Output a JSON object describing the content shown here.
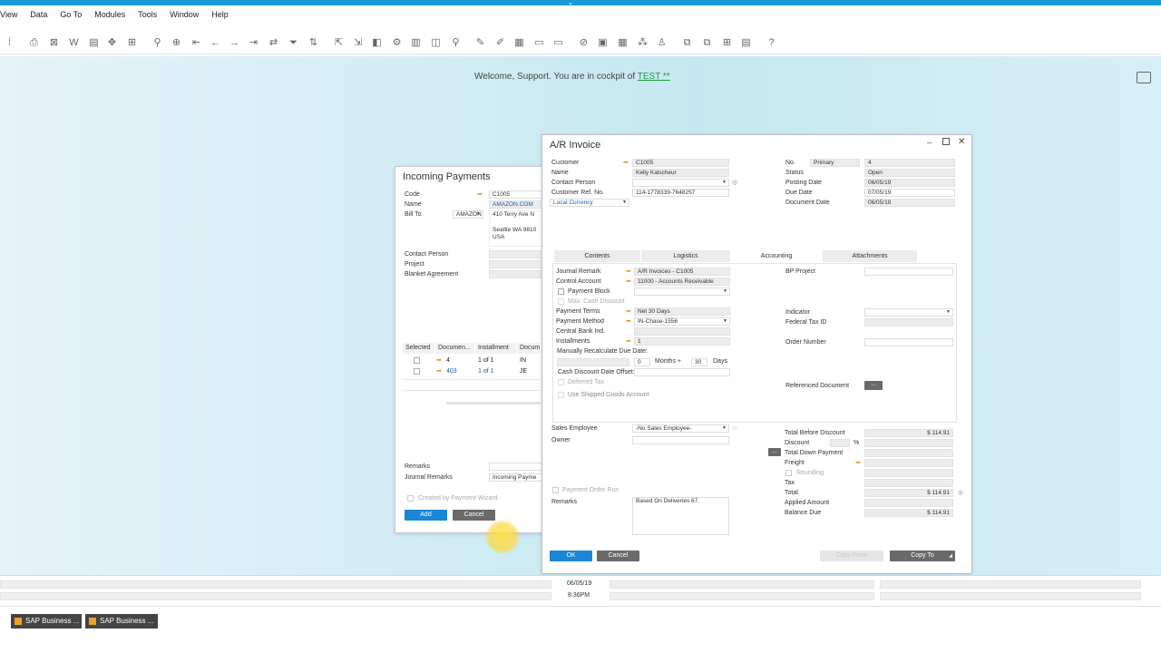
{
  "menu": [
    "View",
    "Data",
    "Go To",
    "Modules",
    "Tools",
    "Window",
    "Help"
  ],
  "welcome": {
    "prefix": "Welcome, Support. You are in cockpit of ",
    "cockpit": "TEST **"
  },
  "incoming": {
    "title": "Incoming Payments",
    "code_label": "Code",
    "code": "C1005",
    "name_label": "Name",
    "name": "AMAZON.COM",
    "billto_label": "Bill To",
    "billto_select": "AMAZON",
    "address1": "410 Terry Ave N",
    "address2": "Seattle WA  9810",
    "address3": "USA",
    "contact_label": "Contact Person",
    "project_label": "Project",
    "blanket_label": "Blanket Agreement",
    "table_headers": [
      "Selected",
      "Documen...",
      "Installment",
      "Docum"
    ],
    "rows": [
      {
        "doc": "4",
        "inst": "1 of 1",
        "type": "IN"
      },
      {
        "doc": "403",
        "inst": "1 of 1",
        "type": "JE"
      }
    ],
    "remarks_label": "Remarks",
    "journal_label": "Journal Remarks",
    "journal": "Incoming Payme",
    "wizard_label": "Created by Payment Wizard",
    "add": "Add",
    "cancel": "Cancel"
  },
  "invoice": {
    "title": "A/R Invoice",
    "customer_label": "Customer",
    "customer": "C1005",
    "name_label": "Name",
    "name": "Kelly Kalscheur",
    "contact_label": "Contact Person",
    "ref_label": "Customer Ref. No.",
    "ref": "114-1778339-7648257",
    "currency": "Local Currency",
    "no_label": "No.",
    "no_series": "Primary",
    "no": "4",
    "status_label": "Status",
    "status": "Open",
    "posting_label": "Posting Date",
    "posting": "06/05/19",
    "due_label": "Due Date",
    "due": "07/05/19",
    "docdate_label": "Document Date",
    "docdate": "06/05/19",
    "tabs": [
      "Contents",
      "Logistics",
      "Accounting",
      "Attachments"
    ],
    "acc": {
      "journal_label": "Journal Remark",
      "journal": "A/R Invoices - C1005",
      "control_label": "Control Account",
      "control": "11000 - Accounts Receivable",
      "block_label": "Payment Block",
      "maxdisc_label": "Max. Cash Discount",
      "terms_label": "Payment Terms",
      "terms": "Net 30 Days",
      "method_label": "Payment Method",
      "method": "IN-Chase-1556",
      "cbank_label": "Central Bank Ind.",
      "install_label": "Installments",
      "install": "1",
      "recalc_label": "Manually Recalculate Due Date:",
      "months_val": "0",
      "months_label": "Months +",
      "days_val": "30",
      "days_label": "Days",
      "offset_label": "Cash Discount Date Offset:",
      "deferred_label": "Deferred Tax",
      "shipped_label": "Use Shipped Goods Account",
      "bpproject_label": "BP Project",
      "indicator_label": "Indicator",
      "fedtax_label": "Federal Tax ID",
      "order_label": "Order Number",
      "refdoc_label": "Referenced Document",
      "refdoc_btn": "..."
    },
    "sales_label": "Sales Employee",
    "sales": "-No Sales Employee-",
    "owner_label": "Owner",
    "porun_label": "Payment Order Run",
    "remarks_label": "Remarks",
    "remarks": "Based On Deliveries 67.",
    "totals": {
      "before_label": "Total Before Discount",
      "before": "$ 114.91",
      "discount_label": "Discount",
      "pct": "%",
      "downpay_label": "Total Down Payment",
      "downpay_btn": "...",
      "freight_label": "Freight",
      "rounding_label": "Rounding",
      "tax_label": "Tax",
      "total_label": "Total",
      "total": "$ 114.91",
      "applied_label": "Applied Amount",
      "balance_label": "Balance Due",
      "balance": "$ 114.91"
    },
    "ok": "OK",
    "cancel": "Cancel",
    "copyfrom": "Copy From",
    "copyto": "Copy To"
  },
  "status": {
    "date": "06/05/19",
    "time": "8:36PM"
  },
  "taskbar": [
    "SAP Business ...",
    "SAP Business ..."
  ]
}
